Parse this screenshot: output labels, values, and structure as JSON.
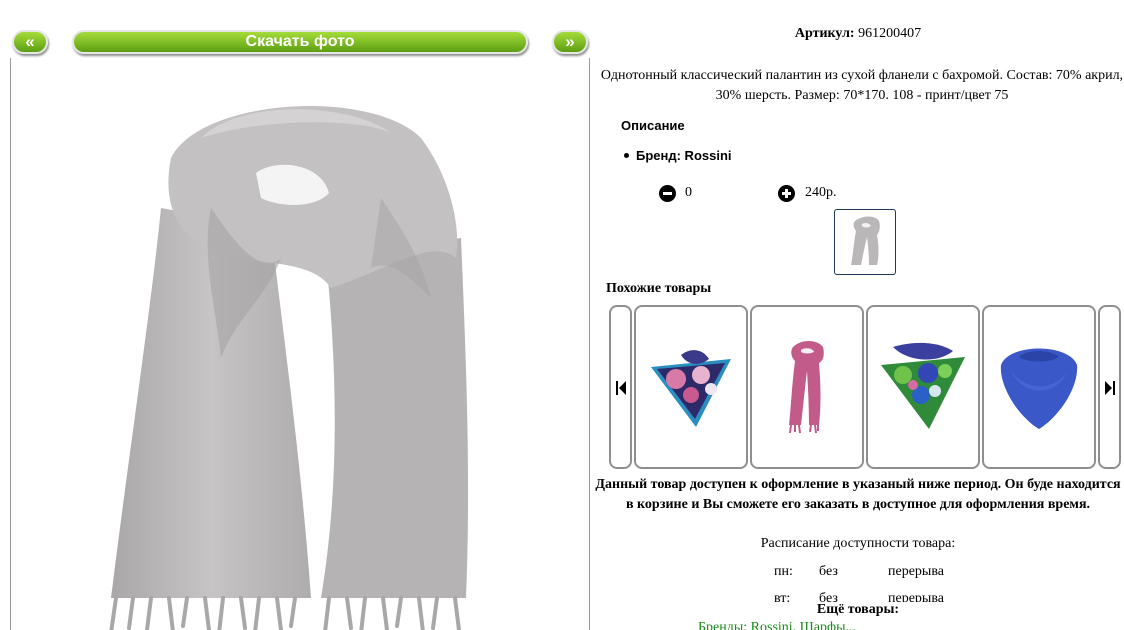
{
  "photo_nav": {
    "prev_label": "«",
    "next_label": "»",
    "download_label": "Скачать фото"
  },
  "product": {
    "article_label": "Артикул:",
    "article_value": "961200407",
    "description": "Однотонный классический палантин из сухой фланели с бахромой. Состав: 70% акрил, 30% шерсть. Размер: 70*170. 108 - принт/цвет 75",
    "description_heading": "Описание",
    "brand": "Бренд: Rossini",
    "quantity": "0",
    "price": "240р."
  },
  "similar": {
    "heading": "Похожие товары",
    "items": [
      {
        "name": "patterned-scarf-blue-pink"
      },
      {
        "name": "pink-scarf"
      },
      {
        "name": "green-floral-scarf"
      },
      {
        "name": "blue-scarf"
      }
    ]
  },
  "availability": {
    "notice": "Данный товар доступен к оформление в указаный ниже период. Он буде находится в корзине и Вы сможете его заказать в доступное для оформления время.",
    "schedule_title": "Расписание доступности товара:",
    "rows": [
      {
        "day": "пн:",
        "w1": "без",
        "w2": "перерыва"
      },
      {
        "day": "вт:",
        "w1": "без",
        "w2": "перерыва"
      }
    ]
  },
  "more": {
    "heading": "Ещё товары:",
    "link": "Бренды: Rossini. Шарфы..."
  },
  "colors": {
    "button_green": "#7cbf22",
    "link_green": "#1a8a1a",
    "scarf_gray": "#bdbbbb"
  }
}
